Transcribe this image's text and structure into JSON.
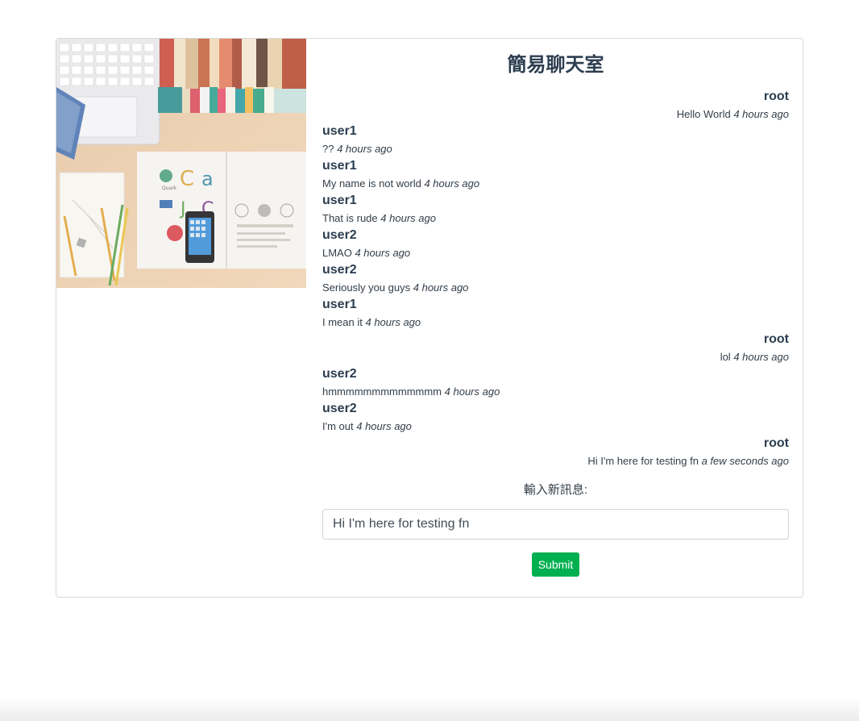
{
  "chat": {
    "title": "簡易聊天室",
    "messages": [
      {
        "user": "root",
        "text": "Hello World",
        "time": "4 hours ago",
        "align": "right"
      },
      {
        "user": "user1",
        "text": "??",
        "time": "4 hours ago",
        "align": "left"
      },
      {
        "user": "user1",
        "text": "My name is not world",
        "time": "4 hours ago",
        "align": "left"
      },
      {
        "user": "user1",
        "text": "That is rude",
        "time": "4 hours ago",
        "align": "left"
      },
      {
        "user": "user2",
        "text": "LMAO",
        "time": "4 hours ago",
        "align": "left"
      },
      {
        "user": "user2",
        "text": "Seriously you guys",
        "time": "4 hours ago",
        "align": "left"
      },
      {
        "user": "user1",
        "text": "I mean it",
        "time": "4 hours ago",
        "align": "left"
      },
      {
        "user": "root",
        "text": "lol",
        "time": "4 hours ago",
        "align": "right"
      },
      {
        "user": "user2",
        "text": "hmmmmmmmmmmmmm",
        "time": "4 hours ago",
        "align": "left"
      },
      {
        "user": "user2",
        "text": "I'm out",
        "time": "4 hours ago",
        "align": "left"
      },
      {
        "user": "root",
        "text": "Hi I'm here for testing fn",
        "time": "a few seconds ago",
        "align": "right"
      }
    ]
  },
  "form": {
    "label": "輸入新訊息:",
    "input_value": "Hi I'm here for testing fn",
    "submit_label": "Submit"
  },
  "colors": {
    "title": "#2c3e50",
    "submit_bg": "#00b050",
    "border": "#d8d8d8"
  },
  "photo": {
    "icon": "desk-workspace-photo"
  }
}
